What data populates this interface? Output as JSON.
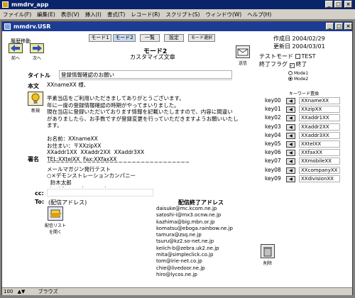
{
  "app": {
    "title": "mmdrv_app"
  },
  "menu": [
    "ファイル(F)",
    "編集(E)",
    "表示(V)",
    "挿入(I)",
    "書式(T)",
    "レコード(R)",
    "スクリプト(S)",
    "ウィンドウ(W)",
    "ヘルプ(H)"
  ],
  "window": {
    "title": "mmdrv.USR"
  },
  "nav": {
    "title": "履歴移動",
    "prev": "前へ",
    "next": "次へ"
  },
  "tabs": [
    "モード1",
    "モード2",
    "一覧",
    "設定",
    "モード選択"
  ],
  "header": {
    "mode": "モード2",
    "subtitle": "カスタマイズ文章",
    "send": "送信"
  },
  "dates": {
    "created_label": "作成日",
    "created": "2004/02/29",
    "updated_label": "更新日",
    "updated": "2004/03/01"
  },
  "flags": {
    "test_label": "テストモード",
    "test_value": "TEST",
    "done_label": "終了フラグ",
    "done_value": "終了",
    "mode1": "Mode1",
    "mode2": "Mode2"
  },
  "form": {
    "title_label": "タイトル",
    "title_value": "登録情報確認のお願い",
    "body_label": "本文",
    "new_label": "新規",
    "body_text": "XXnameXX 様、\n\n平素当店をご利用いただきましてありがとうございます。\n年に一度の登録情報確認の時期がやってまいりました。\n現在当店に登録いただいております情報を記載いたしますので、内容に間違い\nがありましたら、お手数ですが登録変更を行っていただきますようお願いいたし\nます。\n\nお名前：XXnameXX\nお住まい：〒XXzipXX\nXXaddr1XX  XXaddr2XX  XXaddr3XX\nTEL:XXtelXX  Fax:XXfaxXX",
    "sig_label": "署名",
    "sig_text": "~~~~~~~~~~~~~~~~~~~~~~~~~~~~~~~~\nメールマガジン発行テスト\n○×デモンストレーションカンパニー\n  鈴木太郎\n  test@xxxx.demo.co.jp",
    "cc_label": "cc:",
    "to_label": "To:",
    "to_value": "(配信アドレス)",
    "list_btn_line1": "配信リスト",
    "list_btn_line2": "を開く",
    "delete_label": "削除"
  },
  "keywords": {
    "title": "キーワード置換",
    "rows": [
      {
        "key": "key00",
        "value": "XXnameXX"
      },
      {
        "key": "key01",
        "value": "XXzipXX"
      },
      {
        "key": "key02",
        "value": "XXaddr1XX"
      },
      {
        "key": "key03",
        "value": "XXaddr2XX"
      },
      {
        "key": "key04",
        "value": "XXaddr3XX"
      },
      {
        "key": "key05",
        "value": "XXtelXX"
      },
      {
        "key": "key06",
        "value": "XXfaxXX"
      },
      {
        "key": "key07",
        "value": "XXmobileXX"
      },
      {
        "key": "key08",
        "value": "XXcompanyXX"
      },
      {
        "key": "key09",
        "value": "XXdivisionXX"
      }
    ]
  },
  "addresses": {
    "title": "配信終了アドレス",
    "list": [
      "daisuke@mc.kcom.ne.jp",
      "satoshi-i@mx3.ocnw.ne.jp",
      "kazhima@big.mbn.or.jp",
      "komatsu@eboga.rainbow.ne.jp",
      "tamura@zsq.ne.jp",
      "tsuru@kz2.so-net.ne.jp",
      "keiich-b@zebra.uk2.ne.jp",
      "mita@simpleclick.co.jp",
      "tom@irie-net.co.jp",
      "chie@livedoor.ne.jp",
      "hiro@lycos.ne.jp"
    ]
  },
  "status": {
    "zoom": "100",
    "mode": "ブラウズ"
  },
  "colors": {
    "titlebar": "#0a246a",
    "window_title": "#1c3c94",
    "chrome": "#d4d0c8"
  }
}
